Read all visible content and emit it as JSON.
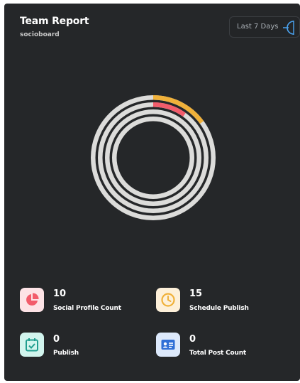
{
  "card": {
    "title": "Team Report",
    "subtitle": "socioboard",
    "range_selector": {
      "label": "Last 7 Days",
      "icon": "time-range-icon"
    }
  },
  "chart_data": {
    "type": "radial-bar",
    "title": "",
    "rings": [
      {
        "value": 15,
        "color": "#f0b13a"
      },
      {
        "value": 10,
        "color": "#f25c6b"
      },
      {
        "value": 0,
        "color": "#dddddd"
      },
      {
        "value": 0,
        "color": "#dddddd"
      }
    ],
    "max": 100,
    "track_color": "#dcdcda"
  },
  "stats": [
    {
      "value": "10",
      "label": "Social Profile Count",
      "icon": "pie-chart-icon",
      "icon_color": "#f25c6b",
      "tile_color": "#fde3e6"
    },
    {
      "value": "15",
      "label": "Schedule Publish",
      "icon": "clock-icon",
      "icon_color": "#f0b13a",
      "tile_color": "#fdf0d9"
    },
    {
      "value": "0",
      "label": "Publish",
      "icon": "calendar-check-icon",
      "icon_color": "#1f9e8f",
      "tile_color": "#d2f5ee"
    },
    {
      "value": "0",
      "label": "Total Post Count",
      "icon": "id-card-icon",
      "icon_color": "#2f6fd6",
      "tile_color": "#dde9fb"
    }
  ]
}
